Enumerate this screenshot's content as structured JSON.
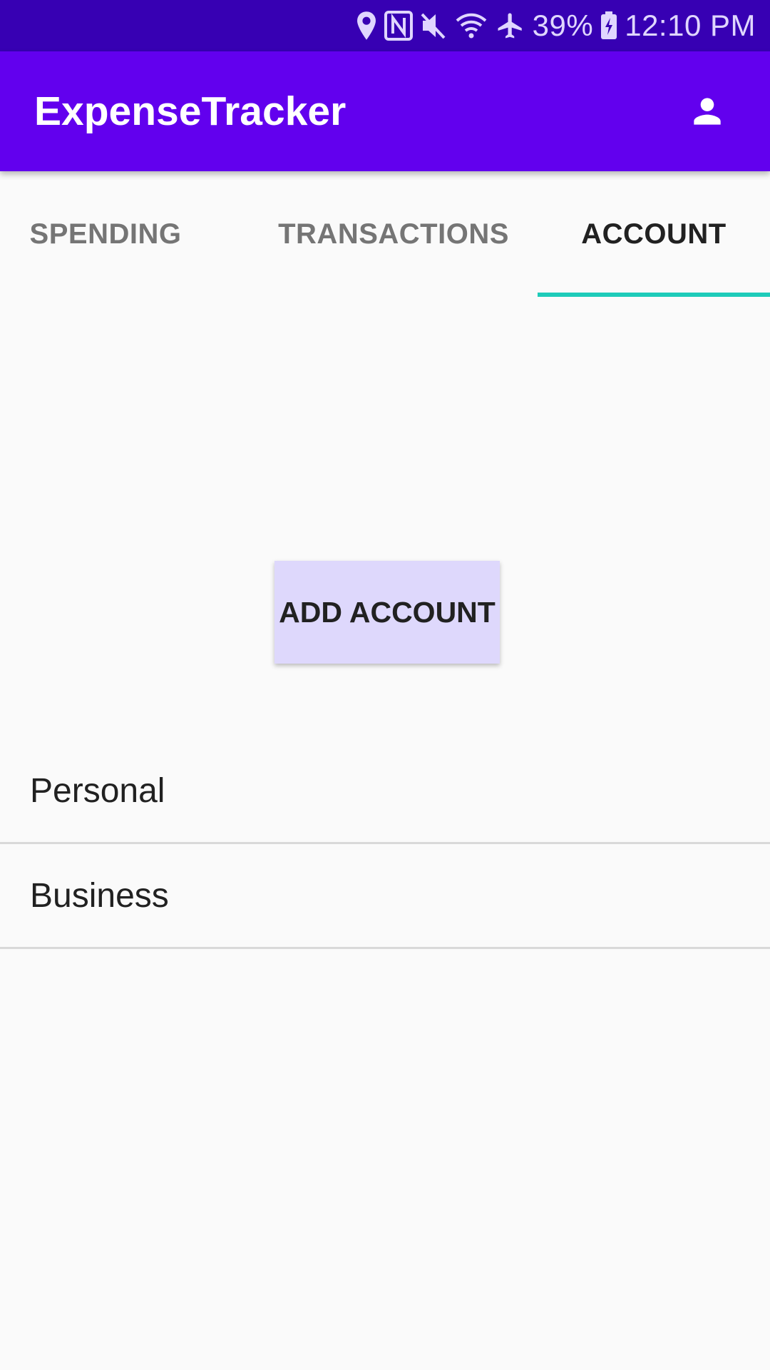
{
  "status_bar": {
    "battery": "39%",
    "time": "12:10 PM",
    "icons": [
      "location-icon",
      "nfc-icon",
      "mute-icon",
      "wifi-icon",
      "airplane-icon",
      "battery-charging-icon"
    ]
  },
  "app_bar": {
    "title": "ExpenseTracker",
    "profile_icon": "person-icon"
  },
  "tabs": [
    {
      "label": "SPENDING",
      "selected": false
    },
    {
      "label": "TRANSACTIONS",
      "selected": false
    },
    {
      "label": "ACCOUNT",
      "selected": true
    }
  ],
  "add_account_label": "ADD ACCOUNT",
  "accounts": [
    {
      "name": "Personal"
    },
    {
      "name": "Business"
    }
  ],
  "colors": {
    "status_bar": "#3700b3",
    "app_bar": "#6200ee",
    "tab_indicator": "#1ecbb9",
    "button_bg": "#ded8fc"
  }
}
